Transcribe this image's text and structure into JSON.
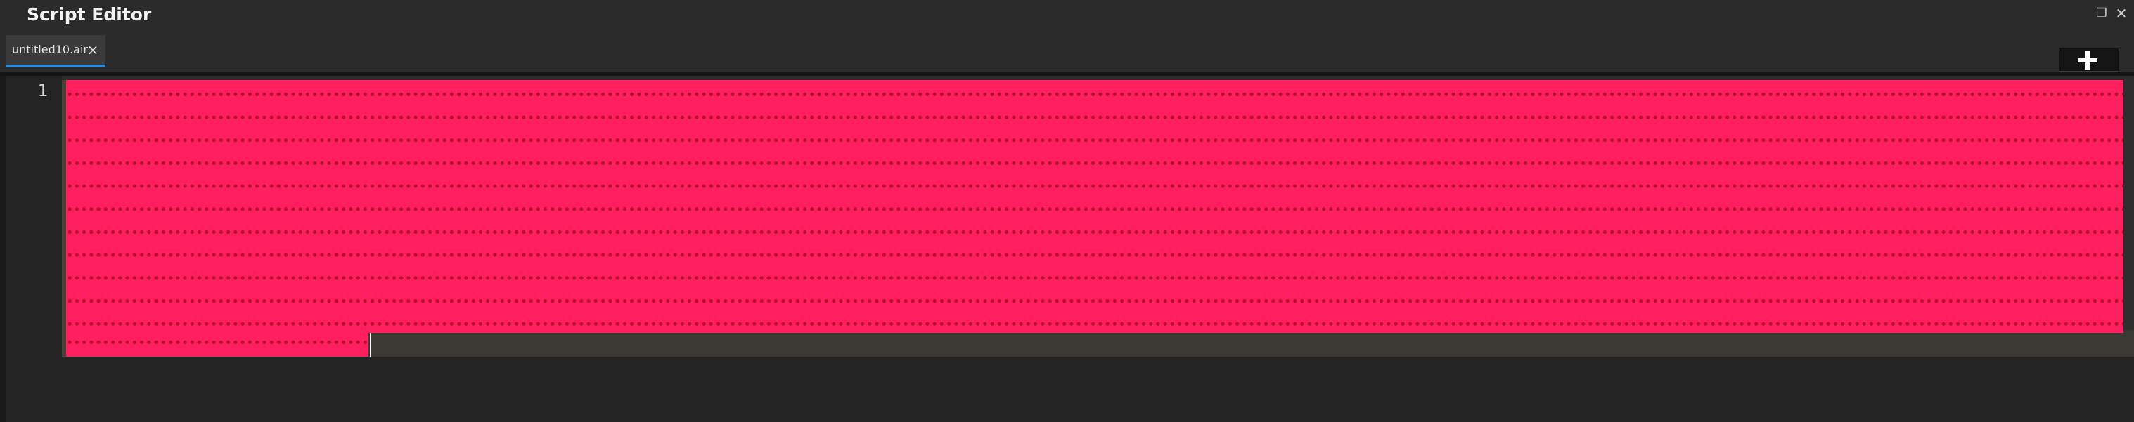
{
  "window": {
    "title": "Script Editor",
    "restore_glyph": "❐",
    "close_glyph": "✕"
  },
  "tabs": [
    {
      "label": "untitled10.air",
      "close_glyph": "×",
      "active": true
    }
  ],
  "toolbar": {
    "add_tab_icon": "plus-icon",
    "menu_icon": "chevron-down-icon"
  },
  "editor": {
    "line_numbers": [
      "1"
    ],
    "selection_color": "#ff1f5e",
    "whitespace_dot_color": "#b8102d",
    "background_color": "#232323",
    "tab_accent_color": "#2f8ad8"
  }
}
